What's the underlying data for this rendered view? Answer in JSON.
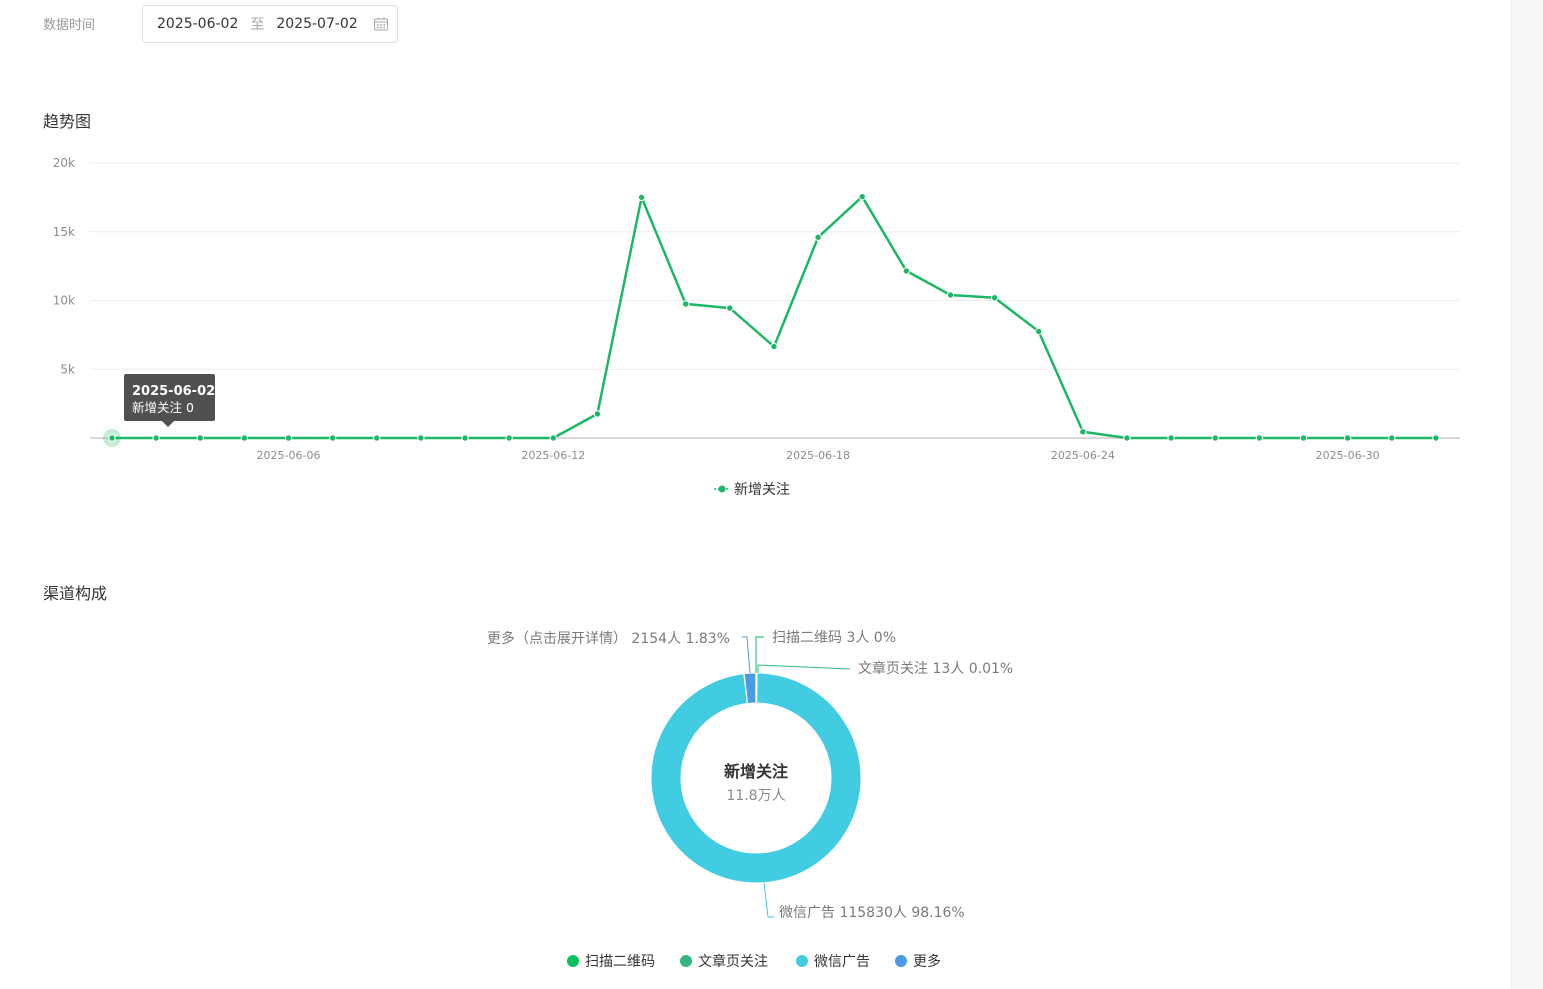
{
  "filter": {
    "label": "数据时间",
    "start_date": "2025-06-02",
    "separator": "至",
    "end_date": "2025-07-02",
    "icon": "calendar-icon"
  },
  "trend": {
    "section_title": "趋势图",
    "tooltip": {
      "date": "2025-06-02",
      "text": "新增关注 0"
    }
  },
  "channel": {
    "section_title": "渠道构成",
    "center_title": "新增关注",
    "center_value": "11.8万人"
  },
  "colors": {
    "line": "#1cb865",
    "qr": "#07c160",
    "article": "#33b77e",
    "wechat_ad": "#42cce1",
    "more": "#4a9be3"
  },
  "chart_data": [
    {
      "type": "line",
      "title": "趋势图",
      "xlabel": "",
      "ylabel": "",
      "x": [
        "2025-06-02",
        "2025-06-03",
        "2025-06-04",
        "2025-06-05",
        "2025-06-06",
        "2025-06-07",
        "2025-06-08",
        "2025-06-09",
        "2025-06-10",
        "2025-06-11",
        "2025-06-12",
        "2025-06-13",
        "2025-06-14",
        "2025-06-15",
        "2025-06-16",
        "2025-06-17",
        "2025-06-18",
        "2025-06-19",
        "2025-06-20",
        "2025-06-21",
        "2025-06-22",
        "2025-06-23",
        "2025-06-24",
        "2025-06-25",
        "2025-06-26",
        "2025-06-27",
        "2025-06-28",
        "2025-06-29",
        "2025-06-30",
        "2025-07-01",
        "2025-07-02"
      ],
      "x_tick_labels": [
        "2025-06-06",
        "2025-06-12",
        "2025-06-18",
        "2025-06-24",
        "2025-06-30"
      ],
      "y_tick_labels": [
        "5k",
        "10k",
        "15k",
        "20k"
      ],
      "ylim": [
        0,
        20000
      ],
      "grid": true,
      "legend": "bottom-center",
      "series": [
        {
          "name": "新增关注",
          "values": [
            0,
            0,
            0,
            0,
            0,
            0,
            0,
            0,
            0,
            0,
            0,
            1750,
            17500,
            9750,
            9450,
            6650,
            14600,
            17550,
            12150,
            10400,
            10200,
            7750,
            450,
            0,
            0,
            0,
            0,
            0,
            0,
            0,
            0
          ]
        }
      ]
    },
    {
      "type": "pie",
      "title": "渠道构成",
      "subtype": "donut",
      "legend": "bottom-center",
      "slices": [
        {
          "name": "扫描二维码",
          "label": "扫描二维码 3人 0%",
          "value": 3,
          "percent": 0
        },
        {
          "name": "文章页关注",
          "label": "文章页关注 13人 0.01%",
          "value": 13,
          "percent": 0.01
        },
        {
          "name": "微信广告",
          "label": "微信广告 115830人 98.16%",
          "value": 115830,
          "percent": 98.16
        },
        {
          "name": "更多",
          "label": "更多（点击展开详情） 2154人 1.83%",
          "value": 2154,
          "percent": 1.83
        }
      ]
    }
  ]
}
